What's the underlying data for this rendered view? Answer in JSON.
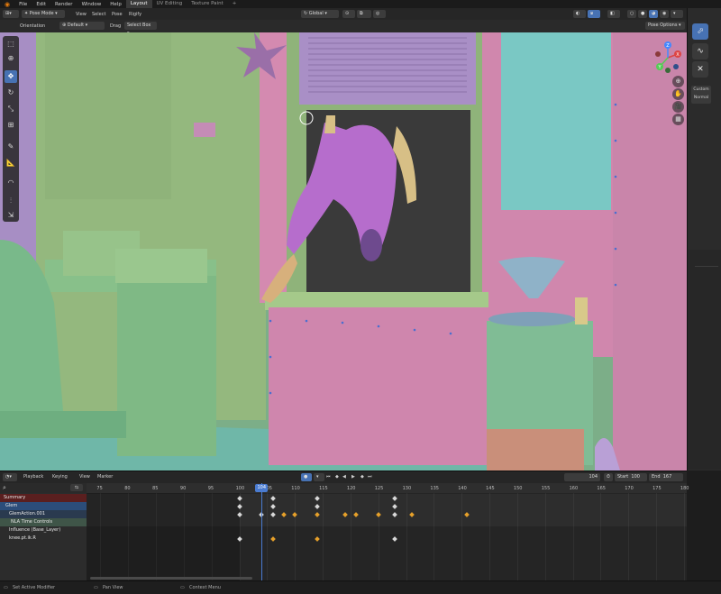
{
  "menu": {
    "items": [
      "File",
      "Edit",
      "Render",
      "Window",
      "Help"
    ],
    "workspaces": [
      "Layout",
      "UV Editing",
      "Texture Paint"
    ],
    "add_tab": "+"
  },
  "viewport_header": {
    "mode": "Pose Mode",
    "menus": [
      "View",
      "Select",
      "Pose",
      "Rigify"
    ],
    "transform_orientation": "Global",
    "pose_options": "Pose Options"
  },
  "tool_settings": {
    "orientation_label": "Orientation",
    "orientation_value": "Default",
    "drag_label": "Drag",
    "drag_value": "Select Box"
  },
  "side_panel": {
    "custom_label": "Custom",
    "normal_label": "Normal"
  },
  "gizmo": {
    "x": "X",
    "y": "Y",
    "z": "Z"
  },
  "timeline": {
    "menus": [
      "Playback",
      "Keying",
      "View",
      "Marker"
    ],
    "current_frame": "104",
    "start_label": "Start",
    "start": "100",
    "end_label": "End",
    "end": "167",
    "frame_indicator": "104",
    "ruler": [
      "75",
      "80",
      "85",
      "90",
      "95",
      "100",
      "105",
      "110",
      "115",
      "120",
      "125",
      "130",
      "135",
      "140",
      "145",
      "150",
      "155",
      "160",
      "165",
      "170",
      "175",
      "180"
    ],
    "channels": [
      {
        "label": "Summary",
        "color": "#5a1f1f"
      },
      {
        "label": "Glem",
        "color": "#2c4d7a"
      },
      {
        "label": "GlemAction.001",
        "color": "#2a3a4f"
      },
      {
        "label": "NLA Time Controls",
        "color": "#3f5548"
      },
      {
        "label": "Influence (Base_Layer)",
        "color": "#2c2c2c"
      },
      {
        "label": "knee.pt.ik.R",
        "color": "#2c2c2c"
      }
    ],
    "keyframes": [
      {
        "row": 0,
        "frames": [
          100,
          106,
          114,
          128
        ],
        "key": "white"
      },
      {
        "row": 1,
        "frames": [
          100,
          106,
          114,
          128
        ],
        "key": "white"
      },
      {
        "row": 2,
        "frames": [
          100,
          104,
          106,
          108,
          110,
          114,
          119,
          121,
          125,
          128,
          131,
          141
        ],
        "key": "mixed"
      },
      {
        "row": 5,
        "frames": [
          100,
          106,
          114,
          128
        ],
        "key": "mixed"
      }
    ]
  },
  "status": {
    "left": "Set Active Modifier",
    "middle": "Pan View",
    "right": "Context Menu"
  },
  "colors": {
    "accent": "#4772b3",
    "key_selected": "#e6a02a",
    "key_unselected": "#d8d8d8",
    "playhead": "#4a7bd0"
  }
}
